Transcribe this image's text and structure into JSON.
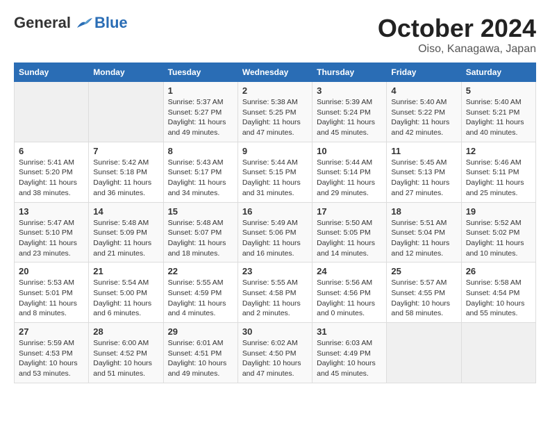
{
  "header": {
    "logo_general": "General",
    "logo_blue": "Blue",
    "title": "October 2024",
    "subtitle": "Oiso, Kanagawa, Japan"
  },
  "days_of_week": [
    "Sunday",
    "Monday",
    "Tuesday",
    "Wednesday",
    "Thursday",
    "Friday",
    "Saturday"
  ],
  "weeks": [
    [
      {
        "day": "",
        "empty": true
      },
      {
        "day": "",
        "empty": true
      },
      {
        "day": "1",
        "sunrise": "5:37 AM",
        "sunset": "5:27 PM",
        "daylight": "11 hours and 49 minutes."
      },
      {
        "day": "2",
        "sunrise": "5:38 AM",
        "sunset": "5:25 PM",
        "daylight": "11 hours and 47 minutes."
      },
      {
        "day": "3",
        "sunrise": "5:39 AM",
        "sunset": "5:24 PM",
        "daylight": "11 hours and 45 minutes."
      },
      {
        "day": "4",
        "sunrise": "5:40 AM",
        "sunset": "5:22 PM",
        "daylight": "11 hours and 42 minutes."
      },
      {
        "day": "5",
        "sunrise": "5:40 AM",
        "sunset": "5:21 PM",
        "daylight": "11 hours and 40 minutes."
      }
    ],
    [
      {
        "day": "6",
        "sunrise": "5:41 AM",
        "sunset": "5:20 PM",
        "daylight": "11 hours and 38 minutes."
      },
      {
        "day": "7",
        "sunrise": "5:42 AM",
        "sunset": "5:18 PM",
        "daylight": "11 hours and 36 minutes."
      },
      {
        "day": "8",
        "sunrise": "5:43 AM",
        "sunset": "5:17 PM",
        "daylight": "11 hours and 34 minutes."
      },
      {
        "day": "9",
        "sunrise": "5:44 AM",
        "sunset": "5:15 PM",
        "daylight": "11 hours and 31 minutes."
      },
      {
        "day": "10",
        "sunrise": "5:44 AM",
        "sunset": "5:14 PM",
        "daylight": "11 hours and 29 minutes."
      },
      {
        "day": "11",
        "sunrise": "5:45 AM",
        "sunset": "5:13 PM",
        "daylight": "11 hours and 27 minutes."
      },
      {
        "day": "12",
        "sunrise": "5:46 AM",
        "sunset": "5:11 PM",
        "daylight": "11 hours and 25 minutes."
      }
    ],
    [
      {
        "day": "13",
        "sunrise": "5:47 AM",
        "sunset": "5:10 PM",
        "daylight": "11 hours and 23 minutes."
      },
      {
        "day": "14",
        "sunrise": "5:48 AM",
        "sunset": "5:09 PM",
        "daylight": "11 hours and 21 minutes."
      },
      {
        "day": "15",
        "sunrise": "5:48 AM",
        "sunset": "5:07 PM",
        "daylight": "11 hours and 18 minutes."
      },
      {
        "day": "16",
        "sunrise": "5:49 AM",
        "sunset": "5:06 PM",
        "daylight": "11 hours and 16 minutes."
      },
      {
        "day": "17",
        "sunrise": "5:50 AM",
        "sunset": "5:05 PM",
        "daylight": "11 hours and 14 minutes."
      },
      {
        "day": "18",
        "sunrise": "5:51 AM",
        "sunset": "5:04 PM",
        "daylight": "11 hours and 12 minutes."
      },
      {
        "day": "19",
        "sunrise": "5:52 AM",
        "sunset": "5:02 PM",
        "daylight": "11 hours and 10 minutes."
      }
    ],
    [
      {
        "day": "20",
        "sunrise": "5:53 AM",
        "sunset": "5:01 PM",
        "daylight": "11 hours and 8 minutes."
      },
      {
        "day": "21",
        "sunrise": "5:54 AM",
        "sunset": "5:00 PM",
        "daylight": "11 hours and 6 minutes."
      },
      {
        "day": "22",
        "sunrise": "5:55 AM",
        "sunset": "4:59 PM",
        "daylight": "11 hours and 4 minutes."
      },
      {
        "day": "23",
        "sunrise": "5:55 AM",
        "sunset": "4:58 PM",
        "daylight": "11 hours and 2 minutes."
      },
      {
        "day": "24",
        "sunrise": "5:56 AM",
        "sunset": "4:56 PM",
        "daylight": "11 hours and 0 minutes."
      },
      {
        "day": "25",
        "sunrise": "5:57 AM",
        "sunset": "4:55 PM",
        "daylight": "10 hours and 58 minutes."
      },
      {
        "day": "26",
        "sunrise": "5:58 AM",
        "sunset": "4:54 PM",
        "daylight": "10 hours and 55 minutes."
      }
    ],
    [
      {
        "day": "27",
        "sunrise": "5:59 AM",
        "sunset": "4:53 PM",
        "daylight": "10 hours and 53 minutes."
      },
      {
        "day": "28",
        "sunrise": "6:00 AM",
        "sunset": "4:52 PM",
        "daylight": "10 hours and 51 minutes."
      },
      {
        "day": "29",
        "sunrise": "6:01 AM",
        "sunset": "4:51 PM",
        "daylight": "10 hours and 49 minutes."
      },
      {
        "day": "30",
        "sunrise": "6:02 AM",
        "sunset": "4:50 PM",
        "daylight": "10 hours and 47 minutes."
      },
      {
        "day": "31",
        "sunrise": "6:03 AM",
        "sunset": "4:49 PM",
        "daylight": "10 hours and 45 minutes."
      },
      {
        "day": "",
        "empty": true
      },
      {
        "day": "",
        "empty": true
      }
    ]
  ]
}
